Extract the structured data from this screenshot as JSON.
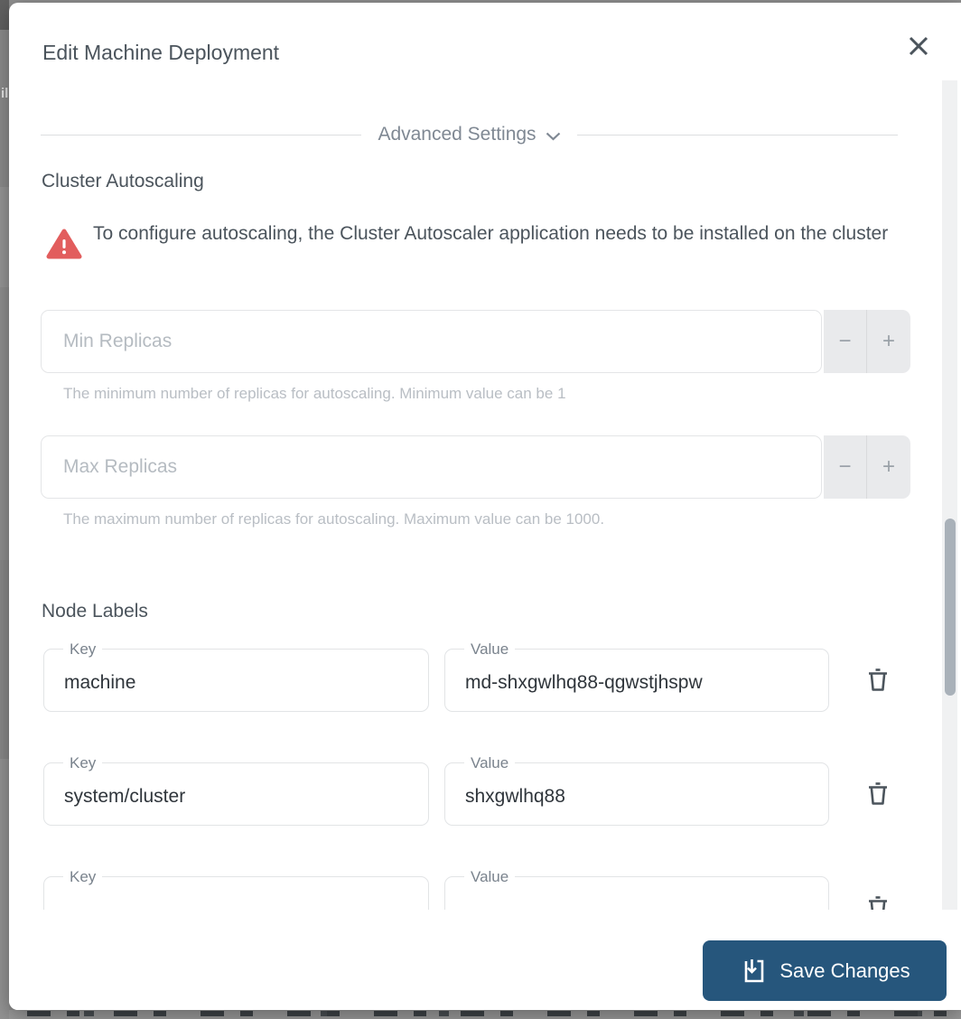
{
  "background": {
    "left_fragment": "il"
  },
  "modal": {
    "title": "Edit Machine Deployment",
    "advanced_settings": {
      "label": "Advanced Settings"
    },
    "cluster_autoscaling": {
      "heading": "Cluster Autoscaling",
      "warning": "To configure autoscaling, the Cluster Autoscaler application needs to be installed on the cluster",
      "min_replicas": {
        "placeholder": "Min Replicas",
        "value": "",
        "hint": "The minimum number of replicas for autoscaling. Minimum value can be 1"
      },
      "max_replicas": {
        "placeholder": "Max Replicas",
        "value": "",
        "hint": "The maximum number of replicas for autoscaling. Maximum value can be 1000."
      },
      "stepper": {
        "decrement": "−",
        "increment": "+"
      }
    },
    "node_labels": {
      "heading": "Node Labels",
      "key_label": "Key",
      "value_label": "Value",
      "rows": [
        {
          "key": "machine",
          "value": "md-shxgwlhq88-qgwstjhspw"
        },
        {
          "key": "system/cluster",
          "value": "shxgwlhq88"
        },
        {
          "key": "",
          "value": ""
        }
      ]
    },
    "footer": {
      "save_label": "Save Changes"
    }
  },
  "colors": {
    "accent_blue": "#26567c",
    "warning_red": "#e25d5d",
    "text_dark": "#4b545c",
    "text_gray": "#7f8893",
    "hint_gray": "#b9bec4"
  }
}
